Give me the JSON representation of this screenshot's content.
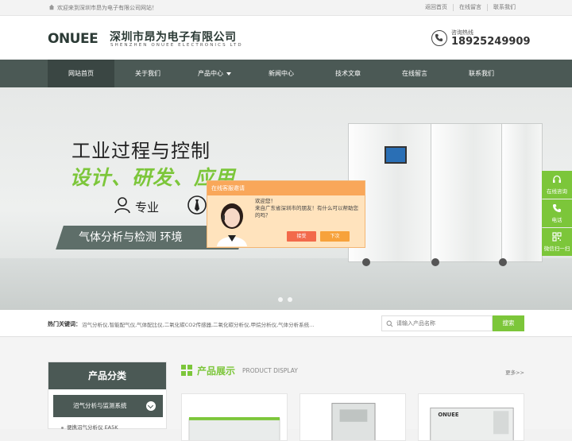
{
  "topbar": {
    "welcome": "欢迎来到深圳市昂为电子有限公司网站！",
    "links": [
      "返回首页",
      "在线留言",
      "联系我们"
    ]
  },
  "header": {
    "logo_mark": "ONUEE",
    "company_cn": "深圳市昂为电子有限公司",
    "company_en": "SHENZHEN ONUEE ELECTRONICS LTD",
    "hotline_label": "咨询热线",
    "hotline_number": "18925249909"
  },
  "nav": {
    "items": [
      {
        "label": "网站首页"
      },
      {
        "label": "关于我们"
      },
      {
        "label": "产品中心"
      },
      {
        "label": "新闻中心"
      },
      {
        "label": "技术文章"
      },
      {
        "label": "在线留言"
      },
      {
        "label": "联系我们"
      }
    ]
  },
  "banner": {
    "title": "工业过程与控制",
    "subtitle": "设计、研发、应用",
    "feature_1": "专业",
    "ribbon": "气体分析与检测 环境"
  },
  "chat": {
    "header": "在线客服邀请",
    "greeting": "欢迎您！",
    "message": "来自广东省深圳市的朋友！有什么可以帮助您的吗？",
    "accept": "接受",
    "later": "下次"
  },
  "float_bar": {
    "items": [
      {
        "label": "在线咨询",
        "icon": "headset-icon"
      },
      {
        "label": "电话",
        "icon": "phone-icon"
      },
      {
        "label": "微信扫一扫",
        "icon": "qrcode-icon"
      }
    ]
  },
  "search": {
    "hot_label": "热门关键词：",
    "hot_keywords": "沼气分析仪,智能配气仪,气体配比仪,二氧化碳CO2传感器,二氧化碳分析仪,甲烷分析仪,气体分析系统...",
    "placeholder": "请输入产品名称",
    "button": "搜索"
  },
  "categories": {
    "title": "产品分类",
    "active_item": "沼气分析与监测系统",
    "sub_item": "便携沼气分析仪 EA5K"
  },
  "products": {
    "title": "产品展示",
    "title_en": "PRODUCT DISPLAY",
    "more": "更多>>"
  },
  "colors": {
    "accent_green": "#7cc63a",
    "nav_dark": "#4b5955",
    "chat_orange": "#f9a75a"
  }
}
